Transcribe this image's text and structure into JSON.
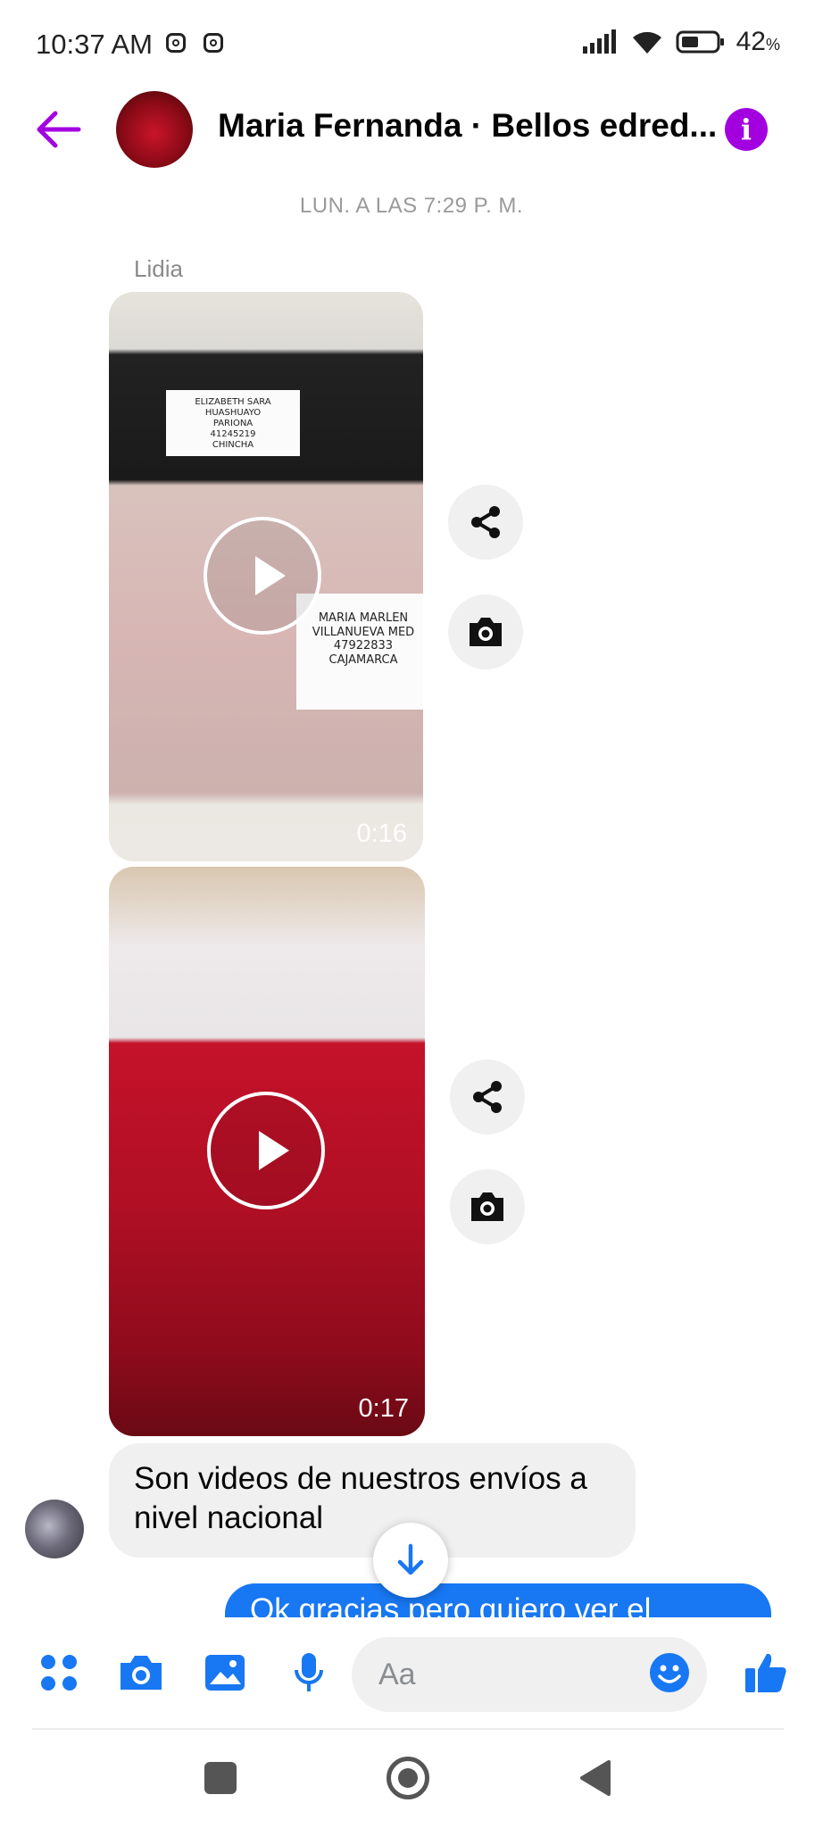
{
  "status_bar": {
    "time": "10:37 AM",
    "notification_icons": [
      "instagram-icon",
      "instagram-icon"
    ],
    "battery_percent": "42",
    "battery_unit": "%"
  },
  "header": {
    "back_icon": "back-arrow-icon",
    "title": "Maria Fernanda · Bellos edred...",
    "info_icon": "info-icon",
    "info_glyph": "i",
    "accent_color": "#a300e0"
  },
  "conversation": {
    "timestamp": "LUN. A LAS 7:29 P. M.",
    "sender_name": "Lidia",
    "videos": [
      {
        "duration": "0:16",
        "label_top": [
          "ELIZABETH SARA",
          "HUASHUAYO",
          "PARIONA",
          "41245219",
          "CHINCHA"
        ],
        "label_bottom": [
          "MARIA MARLEN",
          "VILLANUEVA MED",
          "47922833",
          "CAJAMARCA"
        ]
      },
      {
        "duration": "0:17"
      }
    ],
    "incoming_message": "Son videos de nuestros envíos a nivel nacional",
    "outgoing_message_partial": "Ok gracias pero quiero ver el",
    "outgoing_color": "#1877f2"
  },
  "composer": {
    "placeholder": "Aa",
    "icons": [
      "apps-icon",
      "camera-icon",
      "gallery-icon",
      "microphone-icon",
      "emoji-icon",
      "like-icon"
    ],
    "accent_color": "#1877f2"
  },
  "nav_bar": {
    "icons": [
      "recents-icon",
      "home-icon",
      "back-icon"
    ]
  }
}
